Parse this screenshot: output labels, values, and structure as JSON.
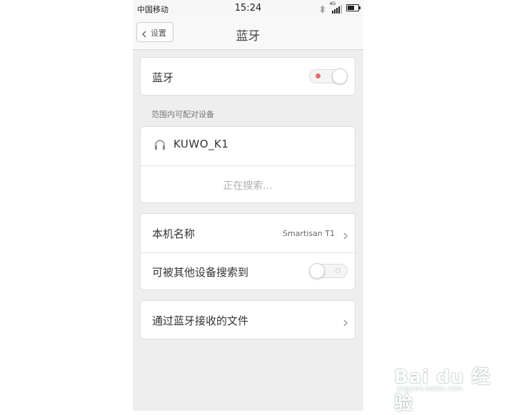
{
  "status_bar": {
    "carrier": "中国移动",
    "time": "15:24",
    "network": "4G"
  },
  "nav": {
    "back_label": "设置",
    "title": "蓝牙"
  },
  "bluetooth": {
    "label": "蓝牙",
    "enabled": true
  },
  "pairable_section": {
    "header": "范围内可配对设备",
    "devices": [
      {
        "name": "KUWO_K1",
        "icon": "headphones-icon"
      }
    ],
    "searching_text": "正在搜索..."
  },
  "device_settings": {
    "name_label": "本机名称",
    "name_value": "Smartisan T1",
    "discoverable_label": "可被其他设备搜索到",
    "discoverable": false
  },
  "received_files": {
    "label": "通过蓝牙接收的文件"
  },
  "watermark": {
    "brand": "Bai du 经验",
    "url": "jingyan.baidu.com"
  },
  "colors": {
    "toggle_on_dot": "#e36e6e",
    "background": "#efeeee",
    "card": "#ffffff"
  }
}
